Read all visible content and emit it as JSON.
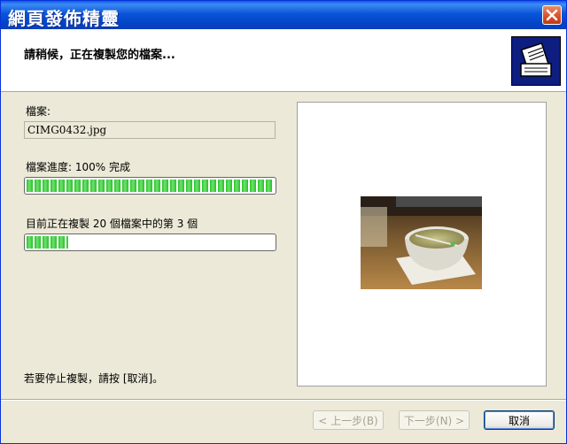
{
  "window": {
    "title": "網頁發佈精靈"
  },
  "header": {
    "status_text": "請稍候，正在複製您的檔案..."
  },
  "file": {
    "label": "檔案:",
    "name": "CIMG0432.jpg"
  },
  "file_progress": {
    "label": "檔案進度: 100% 完成",
    "fraction": 1.0
  },
  "overall_progress": {
    "label": "目前正在複製 20 個檔案中的第 3 個",
    "fraction": 0.17
  },
  "footer": {
    "stop_hint": "若要停止複製，請按 [取消]。",
    "back_label": "< 上一步(B)",
    "next_label": "下一步(N) >",
    "cancel_label": "取消"
  },
  "colors": {
    "titlebar": "#0a55d8",
    "progress": "#28c028",
    "wizard_icon_bg": "#0d1d80"
  }
}
